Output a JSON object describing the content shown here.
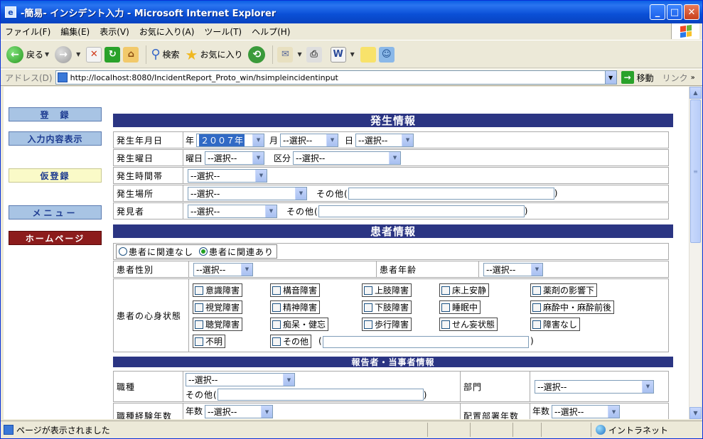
{
  "window": {
    "title": "-簡易- インシデント入力 - Microsoft Internet Explorer",
    "buttons": {
      "minimize": "_",
      "maximize": "□",
      "close": "✕"
    }
  },
  "menu": [
    "ファイル(F)",
    "編集(E)",
    "表示(V)",
    "お気に入り(A)",
    "ツール(T)",
    "ヘルプ(H)"
  ],
  "toolbar": {
    "back": "戻る",
    "search": "検索",
    "favorites": "お気に入り"
  },
  "address": {
    "label": "アドレス(D)",
    "url": "http://localhost:8080/IncidentReport_Proto_win/hsimpleincidentinput",
    "go": "移動",
    "links": "リンク"
  },
  "sidebar": {
    "register": "登　録",
    "show_input": "入力内容表示",
    "temp_register": "仮登録",
    "menu": "メニュー",
    "homepage": "ホームページ"
  },
  "occurrence": {
    "heading": "発生情報",
    "date_label": "発生年月日",
    "year_prefix": "年",
    "year_value": "２００７年",
    "month_prefix": "月",
    "month_value": "--選択--",
    "day_prefix": "日",
    "day_value": "--選択--",
    "weekday_label": "発生曜日",
    "weekday_prefix": "曜日",
    "weekday_value": "--選択--",
    "category_prefix": "区分",
    "category_value": "--選択--",
    "time_label": "発生時間帯",
    "time_value": "--選択--",
    "place_label": "発生場所",
    "place_value": "--選択--",
    "place_other_prefix": "その他(",
    "place_other_suffix": ")",
    "finder_label": "発見者",
    "finder_value": "--選択--",
    "finder_other_prefix": "その他(",
    "finder_other_suffix": ")"
  },
  "patient": {
    "heading": "患者情報",
    "radio_unrelated": "患者に関連なし",
    "radio_related": "患者に関連あり",
    "sex_label": "患者性別",
    "sex_value": "--選択--",
    "age_label": "患者年齢",
    "age_value": "--選択--",
    "state_label": "患者の心身状態",
    "states": [
      "意識障害",
      "構音障害",
      "上肢障害",
      "床上安静",
      "薬剤の影響下",
      "視覚障害",
      "精神障害",
      "下肢障害",
      "睡眠中",
      "麻酔中・麻酔前後",
      "聴覚障害",
      "痴呆・健忘",
      "歩行障害",
      "せん妄状態",
      "障害なし",
      "不明",
      "その他"
    ],
    "other_suffix": "(",
    "other_close": ")"
  },
  "reporter": {
    "heading": "報告者・当事者情報",
    "job_label": "職種",
    "job_value": "--選択--",
    "job_other_prefix": "その他(",
    "job_other_suffix": ")",
    "dept_label": "部門",
    "dept_value": "--選択--",
    "exp_label": "職種経験年数",
    "exp_prefix": "年数",
    "exp_value": "--選択--",
    "assign_label": "配置部署年数",
    "assign_prefix": "年数",
    "assign_value": "--選択--"
  },
  "status": {
    "text": "ページが表示されました",
    "zone": "イントラネット"
  },
  "colors": {
    "section_header": "#2b3583",
    "title_bar": "#0a4fd6",
    "homepage_button": "#8c1c1c"
  }
}
